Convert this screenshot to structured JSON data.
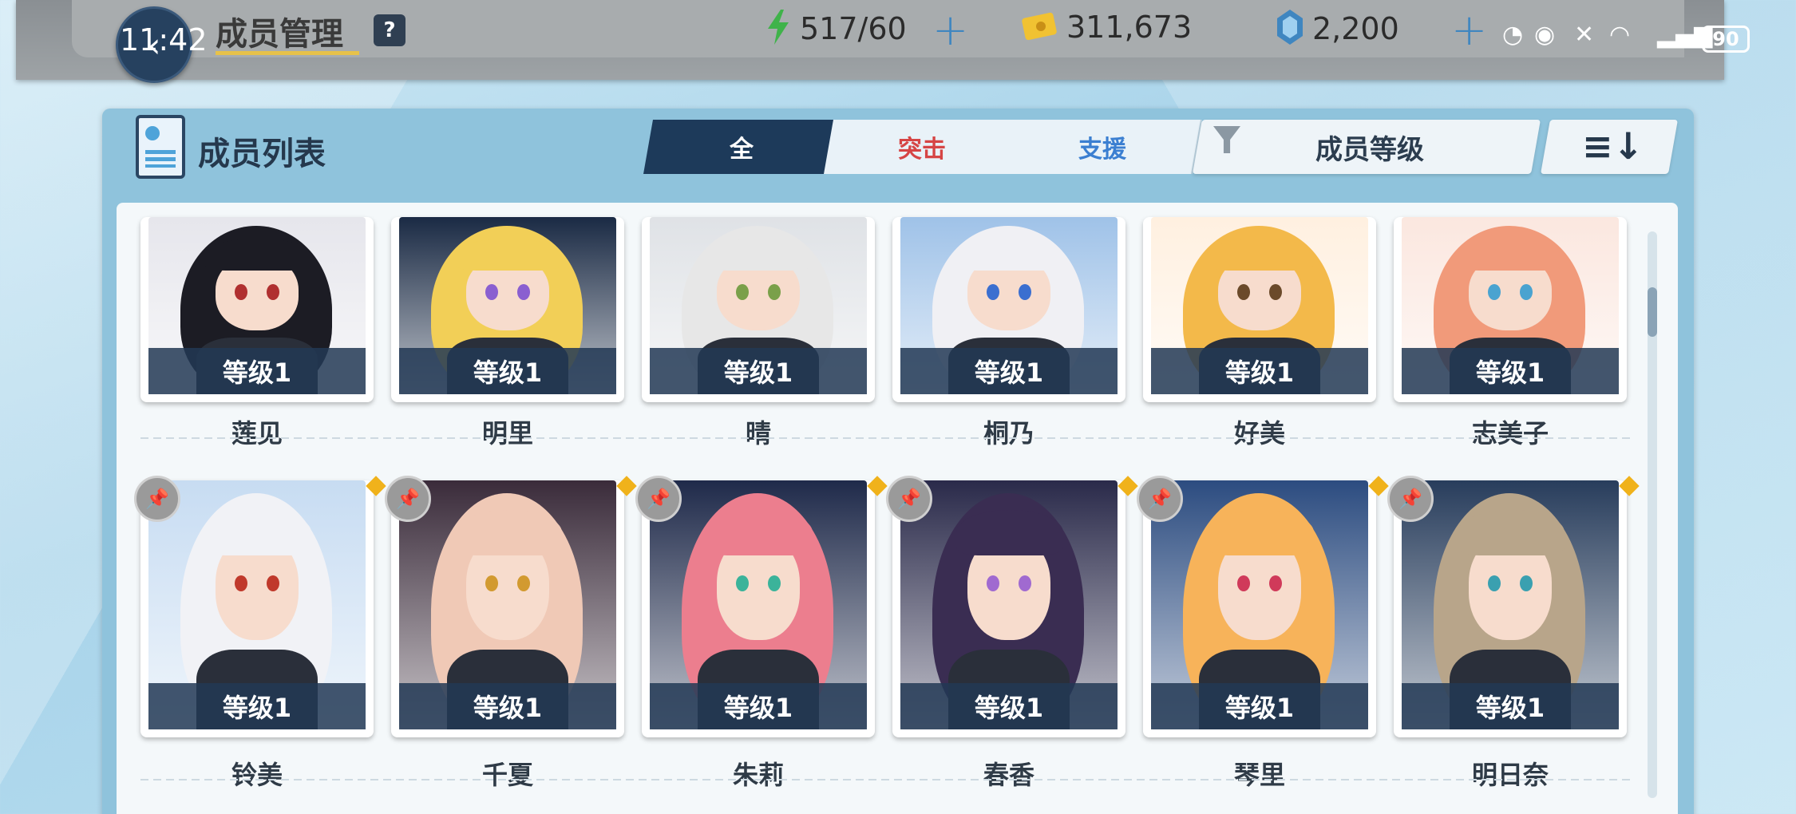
{
  "status_bar": {
    "time": "11:42",
    "battery": "90"
  },
  "header": {
    "title": "成员管理",
    "help": "?",
    "ap": "517/60",
    "credits": "311,673",
    "gems": "2,200",
    "plus": "+"
  },
  "panel": {
    "title": "成员列表",
    "tabs": {
      "all": "全",
      "assault": "突击",
      "support": "支援"
    },
    "filter_label": "成员等级",
    "sort_label": "≡↓"
  },
  "colors": {
    "accent": "#1d3a5a",
    "assault": "#d64545",
    "support": "#3b7fd1",
    "level_bar": "#223855"
  },
  "members": [
    {
      "name": "莲见",
      "level": "等级1",
      "hair": "#1c1c24",
      "eye": "#b03030",
      "bg": "#e6e6ec"
    },
    {
      "name": "明里",
      "level": "等级1",
      "hair": "#f2cf57",
      "eye": "#8a5fd0",
      "bg": "#1a2a44"
    },
    {
      "name": "晴",
      "level": "等级1",
      "hair": "#e7e7e7",
      "eye": "#7aa04a",
      "bg": "#dfe2e6"
    },
    {
      "name": "桐乃",
      "level": "等级1",
      "hair": "#f0f0f4",
      "eye": "#3b6fd0",
      "bg": "#9fc2e8"
    },
    {
      "name": "好美",
      "level": "等级1",
      "hair": "#f3b94a",
      "eye": "#6b4a2a",
      "bg": "#fff0e0"
    },
    {
      "name": "志美子",
      "level": "等级1",
      "hair": "#f19a7a",
      "eye": "#4aa3d0",
      "bg": "#fbe7df"
    },
    {
      "name": "铃美",
      "level": "等级1",
      "hair": "#f1f2f6",
      "eye": "#c0392b",
      "bg": "#c7dcf2"
    },
    {
      "name": "千夏",
      "level": "等级1",
      "hair": "#f0c9b6",
      "eye": "#d29a30",
      "bg": "#3a2b3a"
    },
    {
      "name": "朱莉",
      "level": "等级1",
      "hair": "#ec7e8e",
      "eye": "#3bb39a",
      "bg": "#1f2a4a"
    },
    {
      "name": "春香",
      "level": "等级1",
      "hair": "#3a2d52",
      "eye": "#a06ad0",
      "bg": "#2a2a4a"
    },
    {
      "name": "琴里",
      "level": "等级1",
      "hair": "#f7b35a",
      "eye": "#d03a5a",
      "bg": "#2c4c80"
    },
    {
      "name": "明日奈",
      "level": "等级1",
      "hair": "#b8a58a",
      "eye": "#3aa0b0",
      "bg": "#283d5c"
    }
  ]
}
